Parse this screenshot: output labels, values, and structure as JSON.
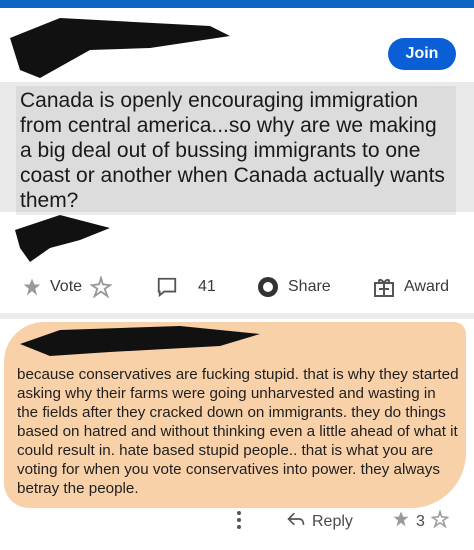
{
  "post": {
    "join_label": "Join",
    "title": "Canada is openly encouraging immigration from central america...so why are we making a big deal out of bussing immigrants to one coast or another when Canada actually wants them?"
  },
  "actions": {
    "vote_label": "Vote",
    "comment_count": "41",
    "share_label": "Share",
    "award_label": "Award"
  },
  "comment": {
    "body": "because conservatives are fucking stupid. that is why they started asking why their farms were going unharvested and wasting in the fields after they cracked down on immigrants. they do things based on hatred and without thinking even a little ahead of what it could result in. hate based stupid people.. that is what you are voting for when you vote conservatives into power. they always betray the people.",
    "reply_label": "Reply",
    "vote_count": "3"
  },
  "colors": {
    "accent": "#0a5fd6",
    "highlight": "#f7c99a",
    "redaction": "#111111"
  },
  "icons": [
    "vote-up-icon",
    "vote-down-icon",
    "comment-icon",
    "share-icon",
    "award-icon",
    "more-icon",
    "reply-icon"
  ]
}
